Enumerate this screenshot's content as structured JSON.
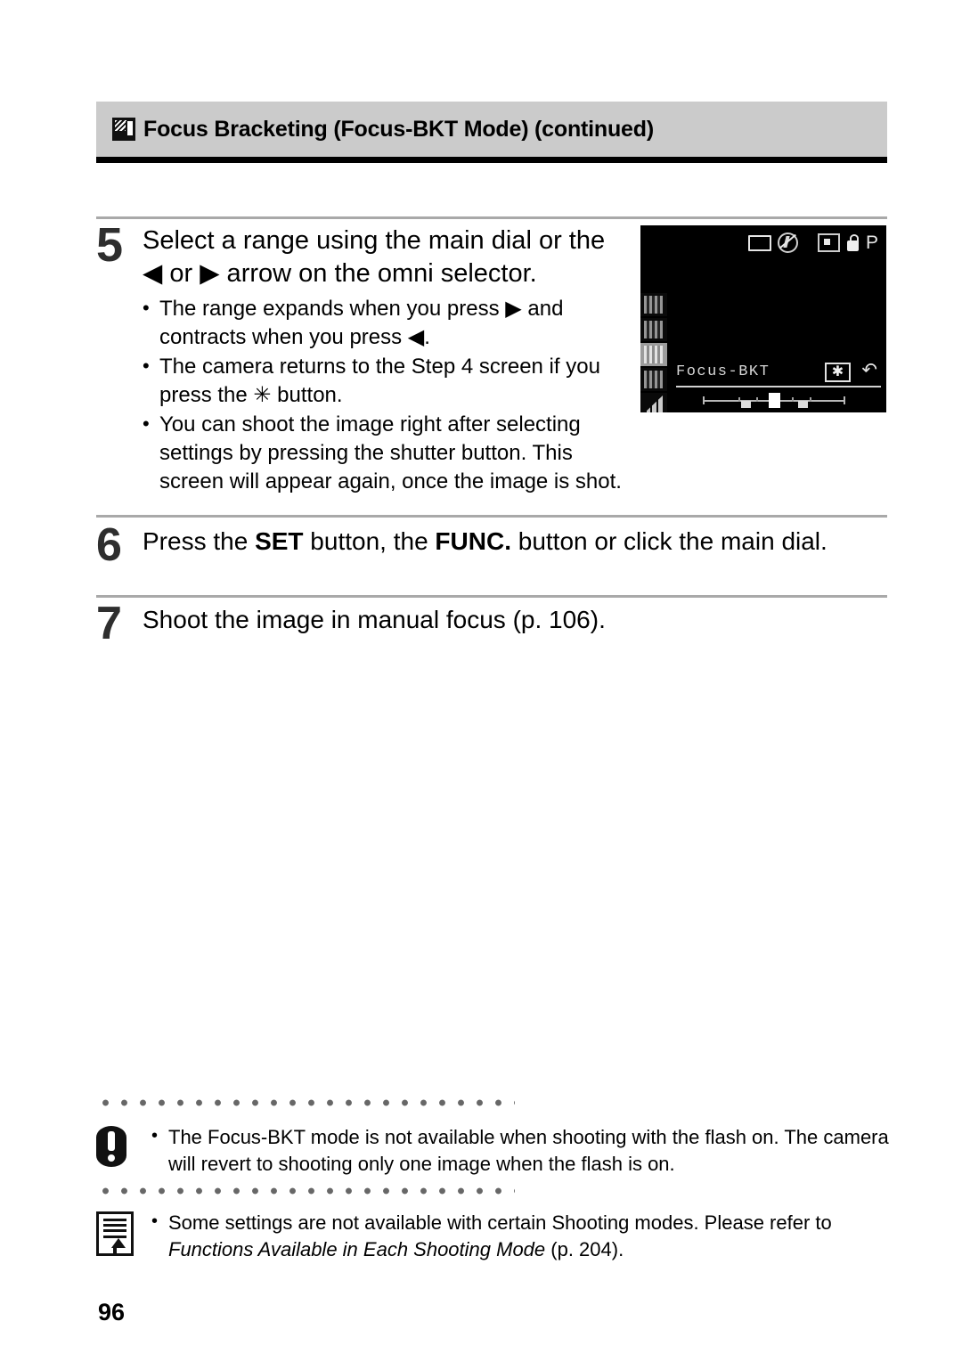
{
  "header": {
    "icon": "focus-bracketing-icon",
    "title": "Focus Bracketing (Focus-BKT Mode) (continued)"
  },
  "steps": [
    {
      "number": "5",
      "title_line1": "Select a range using the main dial or the",
      "title_line2": "◀ or ▶ arrow on the omni selector.",
      "bullet_marker": "•",
      "bullets": [
        "The range expands when you press ▶ and contracts when you press ◀.",
        "The camera returns to the Step 4 screen if you press the ✳ button.",
        "You can shoot the image right after selecting settings by pressing the shutter button. This screen will appear again, once the image is shot."
      ]
    },
    {
      "number": "6",
      "title_prefix": "Press the ",
      "title_bold1": "SET",
      "title_mid1": " button, the ",
      "title_bold2": "FUNC.",
      "title_suffix": " button or click the main dial."
    },
    {
      "number": "7",
      "title": "Shoot the image in manual focus (p. 106)."
    }
  ],
  "lcd": {
    "label": "Focus-BKT",
    "star_glyph": "✱",
    "return_glyph": "↶",
    "mode_letter": "P",
    "top_icons": [
      "frame-icon",
      "flash-off-icon",
      "metering-icon",
      "macro-icon",
      "program-mode-letter"
    ],
    "side_icons": [
      "white-balance-icon",
      "photo-effect-icon",
      "bracketing-icon",
      "iso-icon",
      "image-size-icon"
    ],
    "selected_side_icon_index": 2,
    "slider": {
      "ticks": 5,
      "markers": [
        {
          "pos_percent": 30,
          "main": false
        },
        {
          "pos_percent": 50,
          "main": true
        },
        {
          "pos_percent": 70,
          "main": false
        }
      ]
    }
  },
  "notes": [
    {
      "icon": "warning-icon",
      "marker": "•",
      "text": "The Focus-BKT mode is not available when shooting with the flash on. The camera will revert to shooting only one image when the flash is on."
    },
    {
      "icon": "memo-note-icon",
      "marker": "•",
      "text_before": "Some settings are not available with certain Shooting modes. Please refer to ",
      "text_italic": "Functions Available in Each Shooting Mode",
      "text_after": " (p. 204)."
    }
  ],
  "page_number": "96",
  "colors": {
    "header_bg": "#cbcbcb",
    "header_rule": "#000000",
    "rule": "#a9a9a9",
    "dots": "#676767",
    "step_number": "#2e2e2e",
    "lcd_bg": "#000000"
  }
}
